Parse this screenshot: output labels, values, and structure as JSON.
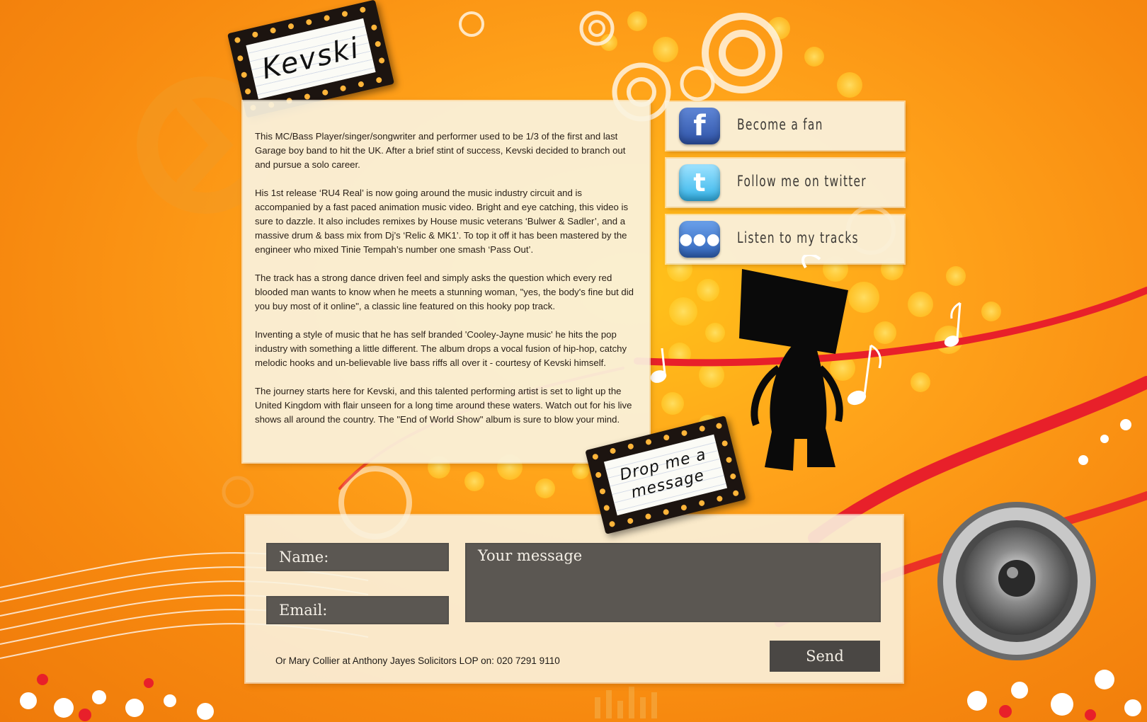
{
  "header": {
    "sign_text": "Kevski"
  },
  "bio": {
    "paragraphs": [
      "This MC/Bass Player/singer/songwriter and performer used to be 1/3 of the first and last Garage boy band to hit the UK. After a brief stint of success, Kevski decided to branch out and pursue a solo career.",
      "His 1st release ‘RU4 Real’ is now going around the music industry circuit and is accompanied by a fast paced animation music video. Bright and eye catching, this video is sure to dazzle. It also includes remixes by House music veterans ‘Bulwer & Sadler’, and a massive drum & bass mix from Dj’s ‘Relic & MK1’. To top it off it has been mastered by the engineer who mixed Tinie Tempah’s number one smash ‘Pass Out’.",
      "The track has a strong dance driven feel and simply asks the question which every red blooded man wants to know when he meets a stunning woman, \"yes, the body's fine but did you buy most of it online\", a classic line featured on this hooky pop track.",
      "Inventing a style of music that he has self branded 'Cooley-Jayne music' he hits the pop industry with something a little different. The album drops a vocal fusion of hip-hop, catchy melodic hooks and un-believable live bass riffs all over it - courtesy of Kevski himself.",
      "The journey starts here for Kevski, and this talented performing artist is set to light up the United Kingdom with flair unseen for a long time around these waters. Watch out for his live shows all around the country. The \"End of World Show\" album is sure to blow your mind."
    ]
  },
  "social": {
    "facebook": {
      "label": "Become a fan",
      "icon": "facebook-icon",
      "glyph": "f"
    },
    "twitter": {
      "label": "Follow me on twitter",
      "icon": "twitter-icon",
      "glyph": "t"
    },
    "myspace": {
      "label": "Listen to my tracks",
      "icon": "myspace-icon",
      "glyph": "●●●"
    }
  },
  "contact": {
    "sign_line1": "Drop me a",
    "sign_line2": "message",
    "name_placeholder": "Name:",
    "email_placeholder": "Email:",
    "message_placeholder": "Your message",
    "send_label": "Send",
    "alt_contact": "Or Mary Collier at Anthony Jayes Solicitors LOP on:  020 7291 9110"
  },
  "colors": {
    "background": "#f7890f",
    "panel": "#faf2de",
    "field": "#5b5752",
    "accent_red": "#e8202a"
  }
}
